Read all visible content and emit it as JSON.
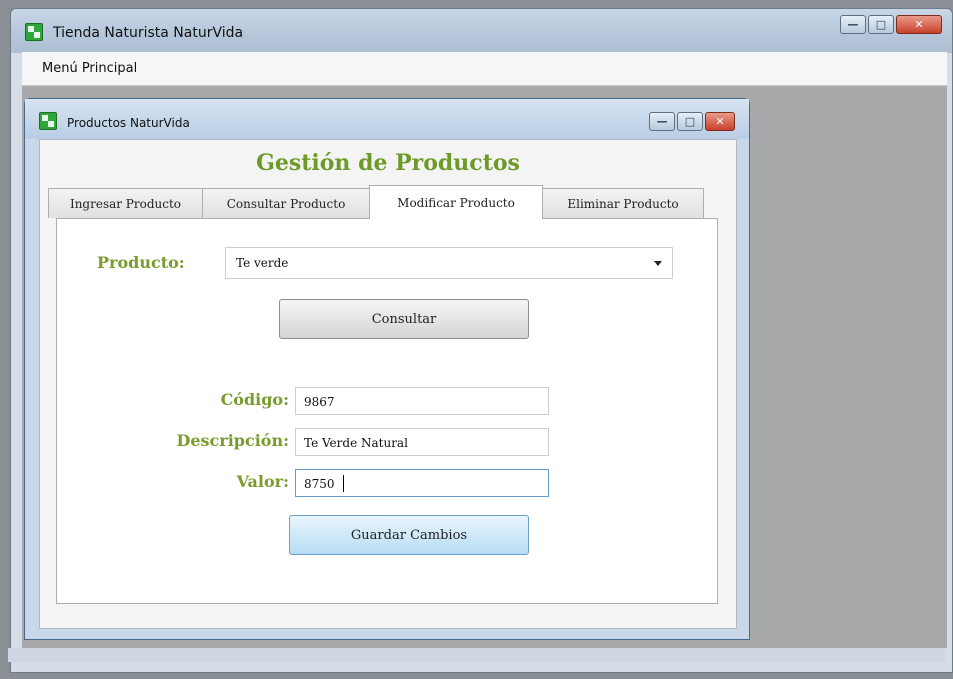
{
  "outer_window": {
    "title": "Tienda Naturista NaturVida",
    "menu": {
      "main_label": "Menú Principal"
    }
  },
  "inner_window": {
    "title": "Productos NaturVida"
  },
  "heading": "Gestión de Productos",
  "tabs": [
    {
      "label": "Ingresar Producto"
    },
    {
      "label": "Consultar Producto"
    },
    {
      "label": "Modificar Producto",
      "active": true
    },
    {
      "label": "Eliminar Producto"
    }
  ],
  "form": {
    "producto_label": "Producto:",
    "producto_selected": "Te verde",
    "consultar_label": "Consultar",
    "codigo_label": "Código:",
    "codigo_value": "9867",
    "descripcion_label": "Descripción:",
    "descripcion_value": "Te Verde Natural",
    "valor_label": "Valor:",
    "valor_value": "8750",
    "guardar_label": "Guardar Cambios"
  },
  "colors": {
    "label_green": "#7a9b2e",
    "heading_green": "#6f9a2a",
    "save_button_blue": "#b7dcf3"
  }
}
